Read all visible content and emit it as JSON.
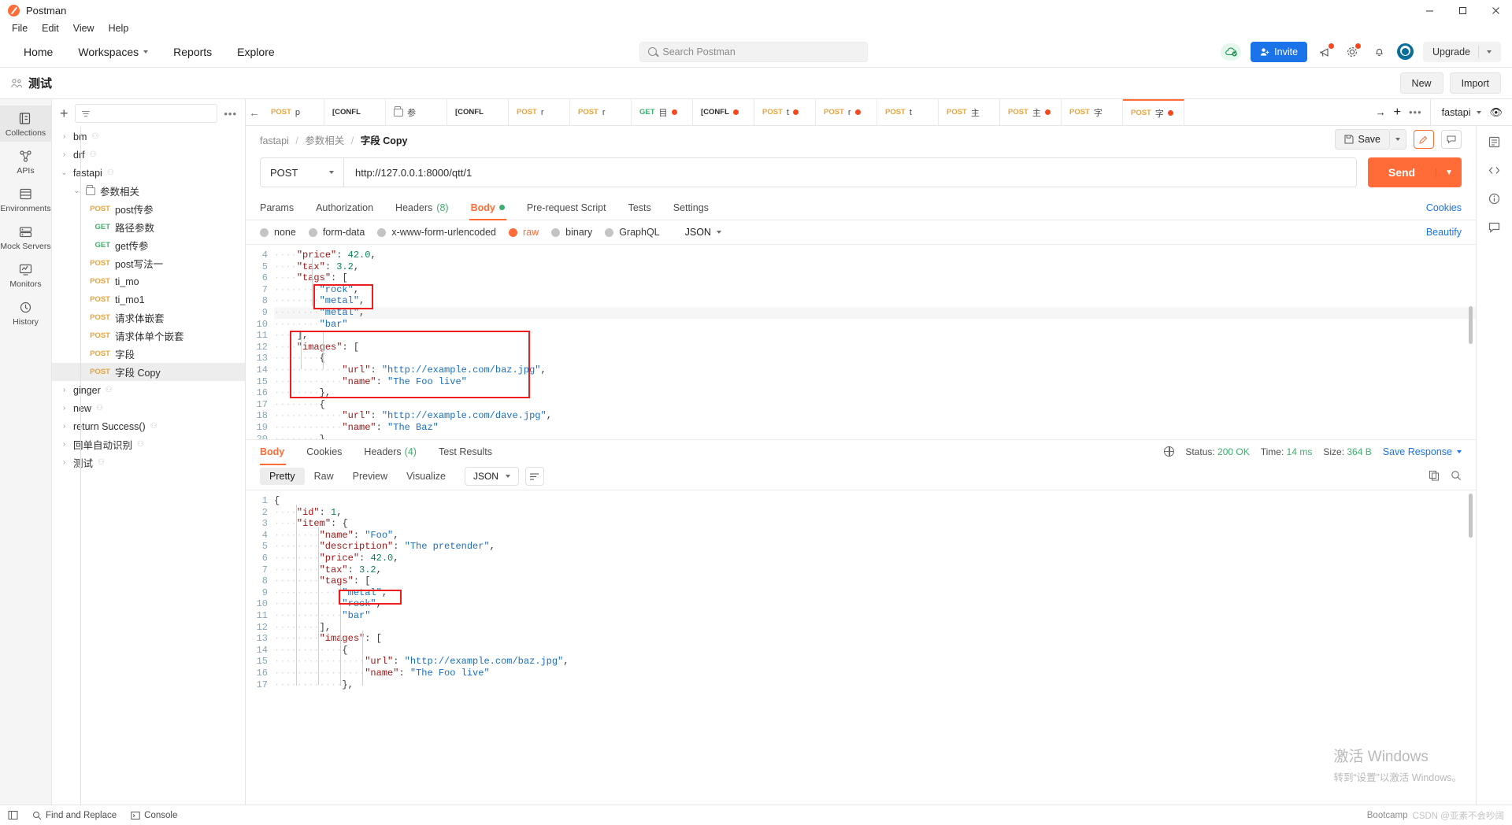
{
  "window": {
    "app_title": "Postman",
    "minimize": "─",
    "maximize": "☐",
    "close": "✕"
  },
  "menubar": [
    "File",
    "Edit",
    "View",
    "Help"
  ],
  "topnav": {
    "items": [
      "Home",
      "Workspaces",
      "Reports",
      "Explore"
    ],
    "search_placeholder": "Search Postman",
    "invite_label": "Invite",
    "upgrade_label": "Upgrade"
  },
  "workspace": {
    "name": "测试",
    "new_label": "New",
    "import_label": "Import"
  },
  "rail": [
    {
      "label": "Collections",
      "icon": "collections-icon"
    },
    {
      "label": "APIs",
      "icon": "apis-icon"
    },
    {
      "label": "Environments",
      "icon": "environments-icon"
    },
    {
      "label": "Mock Servers",
      "icon": "mock-servers-icon"
    },
    {
      "label": "Monitors",
      "icon": "monitors-icon"
    },
    {
      "label": "History",
      "icon": "history-icon"
    }
  ],
  "sidebar": {
    "filter_placeholder": "",
    "tree": [
      {
        "level": 0,
        "chevron": "›",
        "label": "bm",
        "shared": true
      },
      {
        "level": 0,
        "chevron": "›",
        "label": "drf",
        "shared": true
      },
      {
        "level": 0,
        "chevron": "⌄",
        "label": "fastapi",
        "shared": true
      },
      {
        "level": 1,
        "chevron": "⌄",
        "label": "参数相关",
        "folder": true
      },
      {
        "level": 2,
        "method": "POST",
        "label": "post传参"
      },
      {
        "level": 2,
        "method": "GET",
        "label": "路径参数"
      },
      {
        "level": 2,
        "method": "GET",
        "label": "get传参"
      },
      {
        "level": 2,
        "method": "POST",
        "label": "post写法一"
      },
      {
        "level": 2,
        "method": "POST",
        "label": "ti_mo"
      },
      {
        "level": 2,
        "method": "POST",
        "label": "ti_mo1"
      },
      {
        "level": 2,
        "method": "POST",
        "label": "请求体嵌套"
      },
      {
        "level": 2,
        "method": "POST",
        "label": "请求体单个嵌套"
      },
      {
        "level": 2,
        "method": "POST",
        "label": "字段"
      },
      {
        "level": 2,
        "method": "POST",
        "label": "字段 Copy",
        "selected": true
      },
      {
        "level": 0,
        "chevron": "›",
        "label": "ginger",
        "shared": true
      },
      {
        "level": 0,
        "chevron": "›",
        "label": "new",
        "shared": true
      },
      {
        "level": 0,
        "chevron": "›",
        "label": "return Success()",
        "shared": true
      },
      {
        "level": 0,
        "chevron": "›",
        "label": "回单自动识别",
        "shared": true
      },
      {
        "level": 0,
        "chevron": "›",
        "label": "测试",
        "shared": true
      }
    ]
  },
  "tabstrip": {
    "tabs": [
      {
        "method": "POST",
        "name": "p",
        "unsaved": false
      },
      {
        "method": "[CONFL",
        "name": "",
        "unsaved": false
      },
      {
        "method": "",
        "name": "参",
        "unsaved": false,
        "icon": "folder-icon"
      },
      {
        "method": "[CONFL",
        "name": "",
        "unsaved": false
      },
      {
        "method": "POST",
        "name": "r",
        "unsaved": false
      },
      {
        "method": "POST",
        "name": "r",
        "unsaved": false
      },
      {
        "method": "GET",
        "name": "目",
        "unsaved": true
      },
      {
        "method": "[CONFL",
        "name": "",
        "unsaved": true
      },
      {
        "method": "POST",
        "name": "t",
        "unsaved": true
      },
      {
        "method": "POST",
        "name": "r",
        "unsaved": true
      },
      {
        "method": "POST",
        "name": "t",
        "unsaved": false
      },
      {
        "method": "POST",
        "name": "主",
        "unsaved": false
      },
      {
        "method": "POST",
        "name": "主",
        "unsaved": true
      },
      {
        "method": "POST",
        "name": "字",
        "unsaved": false
      },
      {
        "method": "POST",
        "name": "字",
        "unsaved": true,
        "active": true
      }
    ],
    "env_name": "fastapi"
  },
  "request": {
    "breadcrumb": [
      "fastapi",
      "参数相关"
    ],
    "breadcrumb_current": "字段 Copy",
    "save_label": "Save",
    "method": "POST",
    "url": "http://127.0.0.1:8000/qtt/1",
    "send_label": "Send",
    "tabs": [
      {
        "label": "Params"
      },
      {
        "label": "Authorization"
      },
      {
        "label": "Headers",
        "count": "(8)"
      },
      {
        "label": "Body",
        "active": true,
        "dot": true
      },
      {
        "label": "Pre-request Script"
      },
      {
        "label": "Tests"
      },
      {
        "label": "Settings"
      }
    ],
    "cookies_label": "Cookies",
    "body_types": [
      {
        "label": "none",
        "selected": false
      },
      {
        "label": "form-data",
        "selected": false
      },
      {
        "label": "x-www-form-urlencoded",
        "selected": false
      },
      {
        "label": "raw",
        "selected": true
      },
      {
        "label": "binary",
        "selected": false
      },
      {
        "label": "GraphQL",
        "selected": false
      }
    ],
    "format": "JSON",
    "beautify_label": "Beautify",
    "body_lines": [
      {
        "n": 4,
        "text": "\"price\": 42.0,",
        "indent": 1,
        "partial": true
      },
      {
        "n": 5,
        "text": "\"tax\": 3.2,",
        "indent": 1
      },
      {
        "n": 6,
        "text": "\"tags\": [",
        "indent": 1
      },
      {
        "n": 7,
        "text": "\"rock\",",
        "indent": 2
      },
      {
        "n": 8,
        "text": "\"metal\",",
        "indent": 2
      },
      {
        "n": 9,
        "text": "\"metal\",",
        "indent": 2,
        "highlight": true
      },
      {
        "n": 10,
        "text": "\"bar\"",
        "indent": 2
      },
      {
        "n": 11,
        "text": "],",
        "indent": 1
      },
      {
        "n": 12,
        "text": "\"images\": [",
        "indent": 1
      },
      {
        "n": 13,
        "text": "{",
        "indent": 2
      },
      {
        "n": 14,
        "text": "\"url\": \"http://example.com/baz.jpg\",",
        "indent": 3
      },
      {
        "n": 15,
        "text": "\"name\": \"The Foo live\"",
        "indent": 3
      },
      {
        "n": 16,
        "text": "},",
        "indent": 2
      },
      {
        "n": 17,
        "text": "{",
        "indent": 2
      },
      {
        "n": 18,
        "text": "\"url\": \"http://example.com/dave.jpg\",",
        "indent": 3
      },
      {
        "n": 19,
        "text": "\"name\": \"The Baz\"",
        "indent": 3
      },
      {
        "n": 20,
        "text": "}",
        "indent": 2
      }
    ]
  },
  "response": {
    "tabs": [
      {
        "label": "Body",
        "active": true
      },
      {
        "label": "Cookies"
      },
      {
        "label": "Headers",
        "count": "(4)"
      },
      {
        "label": "Test Results"
      }
    ],
    "status_label": "Status:",
    "status_value": "200 OK",
    "time_label": "Time:",
    "time_value": "14 ms",
    "size_label": "Size:",
    "size_value": "364 B",
    "save_response_label": "Save Response",
    "view_modes": [
      {
        "label": "Pretty",
        "on": true
      },
      {
        "label": "Raw"
      },
      {
        "label": "Preview"
      },
      {
        "label": "Visualize"
      }
    ],
    "format": "JSON",
    "body_lines": [
      {
        "n": 1,
        "text": "{",
        "indent": 0
      },
      {
        "n": 2,
        "text": "\"id\": 1,",
        "indent": 1
      },
      {
        "n": 3,
        "text": "\"item\": {",
        "indent": 1
      },
      {
        "n": 4,
        "text": "\"name\": \"Foo\",",
        "indent": 2
      },
      {
        "n": 5,
        "text": "\"description\": \"The pretender\",",
        "indent": 2
      },
      {
        "n": 6,
        "text": "\"price\": 42.0,",
        "indent": 2
      },
      {
        "n": 7,
        "text": "\"tax\": 3.2,",
        "indent": 2
      },
      {
        "n": 8,
        "text": "\"tags\": [",
        "indent": 2
      },
      {
        "n": 9,
        "text": "\"metal\",",
        "indent": 3
      },
      {
        "n": 10,
        "text": "\"rock\",",
        "indent": 3
      },
      {
        "n": 11,
        "text": "\"bar\"",
        "indent": 3
      },
      {
        "n": 12,
        "text": "],",
        "indent": 2
      },
      {
        "n": 13,
        "text": "\"images\": [",
        "indent": 2
      },
      {
        "n": 14,
        "text": "{",
        "indent": 3
      },
      {
        "n": 15,
        "text": "\"url\": \"http://example.com/baz.jpg\",",
        "indent": 4,
        "link": true
      },
      {
        "n": 16,
        "text": "\"name\": \"The Foo live\"",
        "indent": 4
      },
      {
        "n": 17,
        "text": "},",
        "indent": 3
      }
    ]
  },
  "statusbar": {
    "find_replace": "Find and Replace",
    "console": "Console",
    "right_note": "Bootcamp"
  },
  "watermark": {
    "line1": "激活 Windows",
    "line2": "转到“设置”以激活 Windows。",
    "csdn": "CSDN @亚素不会吵阔"
  },
  "colors": {
    "accent": "#ff6c37",
    "link": "#1a73e8",
    "get": "#3dae6d",
    "post": "#e8a33d",
    "red_box": "#ee1c1c"
  }
}
